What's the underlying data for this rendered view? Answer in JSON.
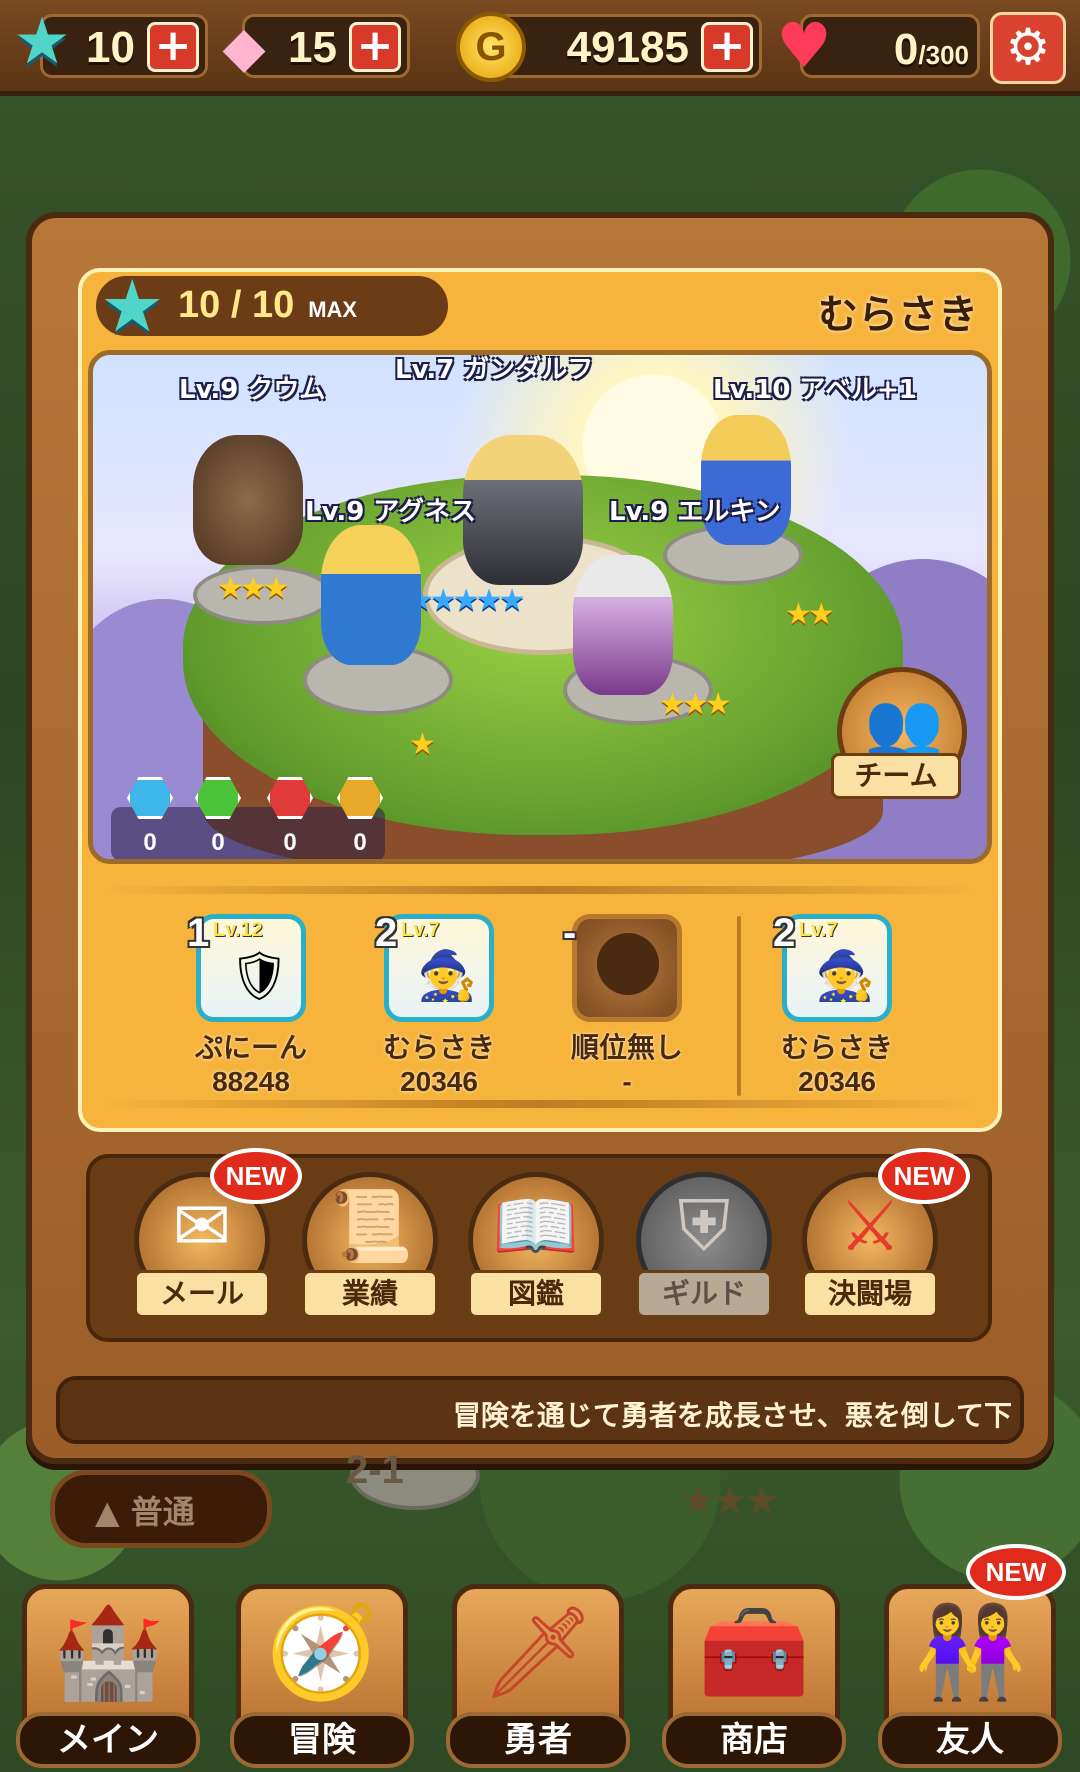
{
  "top_bar": {
    "stars": "10",
    "gems": "15",
    "gold": "49185",
    "hearts": "0",
    "hearts_max": "/300",
    "plus": "+",
    "settings_icon": "gear-icon"
  },
  "team": {
    "star_count": "10 / 10",
    "star_max": "MAX",
    "name": "むらさき",
    "button_label": "チーム"
  },
  "heroes": [
    {
      "label": "Lv.9 クウム",
      "stars": "★★★"
    },
    {
      "label": "Lv.7 ガンダルフ",
      "stars": "★★★★★"
    },
    {
      "label": "Lv.10 アベル+1",
      "stars": "★★"
    },
    {
      "label": "Lv.9 アグネス",
      "stars": "★"
    },
    {
      "label": "Lv.9 エルキン",
      "stars": "★★★"
    }
  ],
  "gems": [
    "0",
    "0",
    "0",
    "0"
  ],
  "gem_colors": [
    "#3fb6e8",
    "#4cc43a",
    "#e03a3a",
    "#e8a82a"
  ],
  "rankings": [
    {
      "rank": "1",
      "level": "Lv.12",
      "name": "ぷにーん",
      "score": "88248"
    },
    {
      "rank": "2",
      "level": "Lv.7",
      "name": "むらさき",
      "score": "20346"
    },
    {
      "rank": "-",
      "level": "",
      "name": "順位無し",
      "score": "-"
    },
    {
      "rank": "2",
      "level": "Lv.7",
      "name": "むらさき",
      "score": "20346"
    }
  ],
  "menu": [
    {
      "label": "メール",
      "icon": "mail-icon",
      "badge": "NEW"
    },
    {
      "label": "業績",
      "icon": "scroll-icon",
      "badge": ""
    },
    {
      "label": "図鑑",
      "icon": "book-icon",
      "badge": ""
    },
    {
      "label": "ギルド",
      "icon": "shield-icon",
      "badge": ""
    },
    {
      "label": "決闘場",
      "icon": "swords-icon",
      "badge": "NEW"
    }
  ],
  "ticker": "冒険を通じて勇者を成長させ、悪を倒して下",
  "difficulty": "▲ 普通",
  "stage": "2-1",
  "nav": [
    {
      "label": "メイン",
      "icon": "castle-icon",
      "badge": ""
    },
    {
      "label": "冒険",
      "icon": "map-icon",
      "badge": ""
    },
    {
      "label": "勇者",
      "icon": "sword-icon",
      "badge": ""
    },
    {
      "label": "商店",
      "icon": "chest-icon",
      "badge": ""
    },
    {
      "label": "友人",
      "icon": "friends-icon",
      "badge": "NEW"
    }
  ]
}
